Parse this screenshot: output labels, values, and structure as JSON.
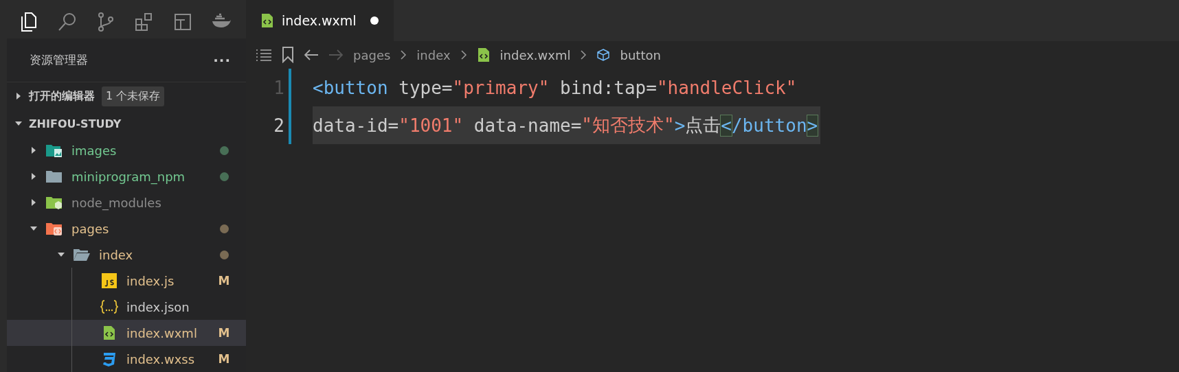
{
  "activity_bar": [
    {
      "kind": "files",
      "selected": true
    },
    {
      "kind": "search",
      "selected": false
    },
    {
      "kind": "git",
      "selected": false
    },
    {
      "kind": "extensions",
      "selected": false
    },
    {
      "kind": "layout",
      "selected": false
    },
    {
      "kind": "docker",
      "selected": false
    }
  ],
  "sidebar": {
    "title": "资源管理器",
    "more": "···",
    "sections": [
      {
        "title": "打开的编辑器",
        "expanded": false,
        "badge": "1 个未保存"
      },
      {
        "title": "ZHIFOU-STUDY",
        "expanded": true
      }
    ],
    "tree": [
      {
        "label": "images",
        "kind": "images-folder",
        "color": "#73c991",
        "dot": true,
        "expanded": false,
        "selected": false
      },
      {
        "label": "miniprogram_npm",
        "kind": "folder",
        "color": "#73c991",
        "dot": true,
        "expanded": false,
        "selected": false
      },
      {
        "label": "node_modules",
        "kind": "node-folder",
        "color": "#8c8c8c",
        "expanded": false,
        "selected": false
      },
      {
        "label": "pages",
        "kind": "pages-folder",
        "color": "#e2c08d",
        "dot": true,
        "expanded": true,
        "selected": false,
        "children": [
          {
            "label": "index",
            "kind": "open-folder",
            "color": "#e2c08d",
            "dot": true,
            "expanded": true,
            "selected": false,
            "children": [
              {
                "label": "index.js",
                "kind": "js",
                "color": "#e2c08d",
                "badge": "M",
                "selected": false
              },
              {
                "label": "index.json",
                "kind": "json",
                "color": "#cccccc",
                "selected": false
              },
              {
                "label": "index.wxml",
                "kind": "wxml",
                "color": "#e2c08d",
                "badge": "M",
                "selected": true
              },
              {
                "label": "index.wxss",
                "kind": "css",
                "color": "#e2c08d",
                "badge": "M",
                "selected": false
              }
            ]
          }
        ]
      }
    ]
  },
  "tabs": [
    {
      "label": "index.wxml",
      "kind": "wxml",
      "selected": true,
      "unsaved": true
    }
  ],
  "breadcrumbs": [
    {
      "label": "pages",
      "kind": "path"
    },
    {
      "label": "index",
      "kind": "path"
    },
    {
      "label": "index.wxml",
      "kind": "wxml"
    },
    {
      "label": "button",
      "kind": "element"
    }
  ],
  "editor": {
    "lines": [
      {
        "number": "1",
        "current": false,
        "tokens": [
          {
            "kind": "tag",
            "text": "<button"
          },
          {
            "kind": "text",
            "text": " type="
          },
          {
            "kind": "string",
            "text": "\"primary\""
          },
          {
            "kind": "text",
            "text": " bind:tap="
          },
          {
            "kind": "string",
            "text": "\"handleClick\""
          }
        ]
      },
      {
        "number": "2",
        "current": true,
        "tokens": [
          {
            "kind": "text",
            "text": "data-id="
          },
          {
            "kind": "string",
            "text": "\"1001\""
          },
          {
            "kind": "text",
            "text": " data-name="
          },
          {
            "kind": "string",
            "text": "\"知否技术\""
          },
          {
            "kind": "tag",
            "text": ">"
          },
          {
            "kind": "text",
            "text": "点击"
          },
          {
            "kind": "bracket",
            "text": "<"
          },
          {
            "kind": "tag",
            "text": "/button"
          },
          {
            "kind": "bracket",
            "text": ">"
          }
        ]
      }
    ]
  }
}
